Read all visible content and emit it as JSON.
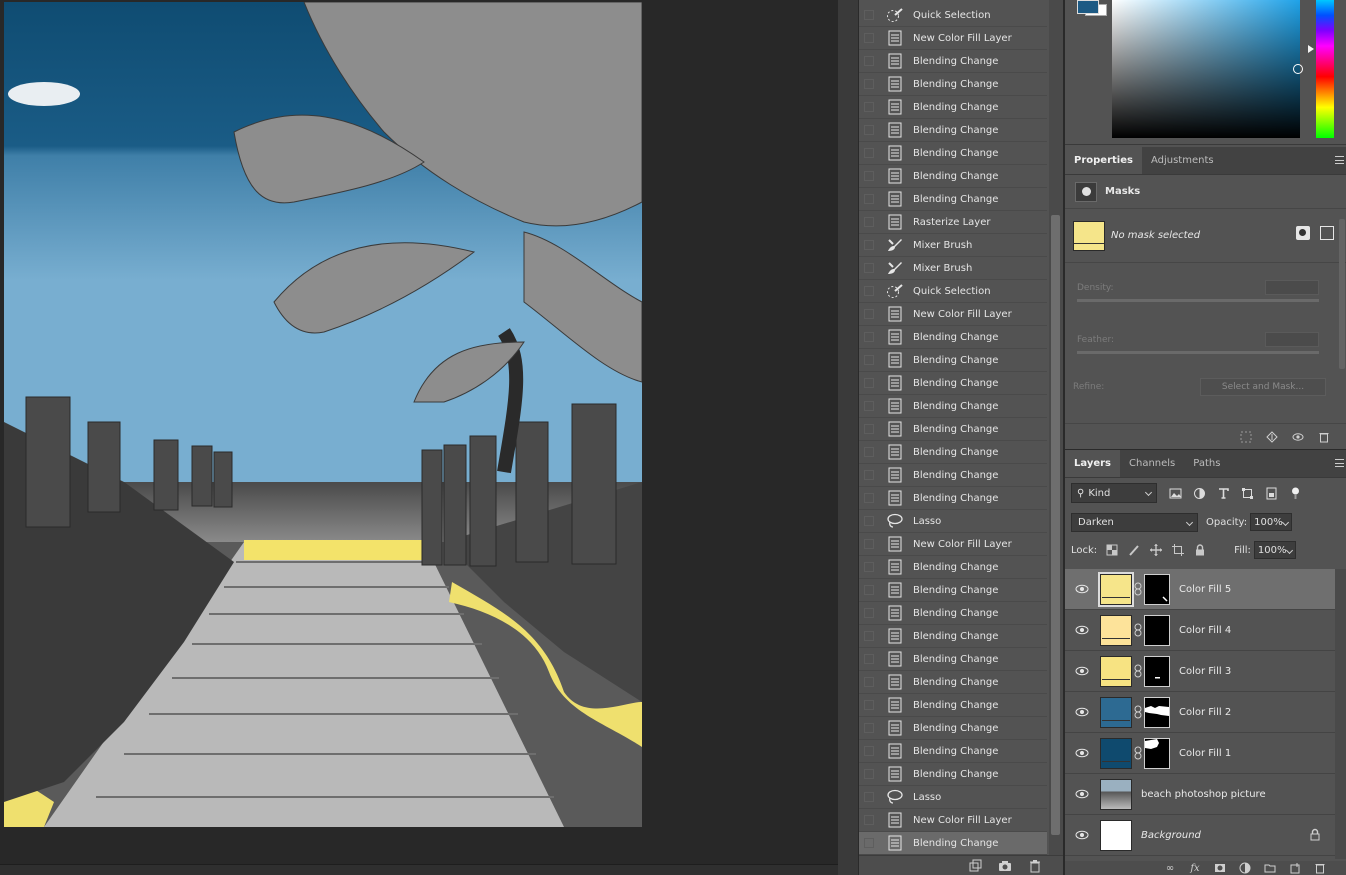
{
  "history": {
    "items": [
      {
        "label": "Quick Selection",
        "icon": "quick-selection-icon"
      },
      {
        "label": "New Color Fill Layer",
        "icon": "history-doc-icon"
      },
      {
        "label": "Blending Change",
        "icon": "history-doc-icon"
      },
      {
        "label": "Blending Change",
        "icon": "history-doc-icon"
      },
      {
        "label": "Blending Change",
        "icon": "history-doc-icon"
      },
      {
        "label": "Blending Change",
        "icon": "history-doc-icon"
      },
      {
        "label": "Blending Change",
        "icon": "history-doc-icon"
      },
      {
        "label": "Blending Change",
        "icon": "history-doc-icon"
      },
      {
        "label": "Blending Change",
        "icon": "history-doc-icon"
      },
      {
        "label": "Rasterize Layer",
        "icon": "history-doc-icon"
      },
      {
        "label": "Mixer Brush",
        "icon": "mixer-brush-icon"
      },
      {
        "label": "Mixer Brush",
        "icon": "mixer-brush-icon"
      },
      {
        "label": "Quick Selection",
        "icon": "quick-selection-icon"
      },
      {
        "label": "New Color Fill Layer",
        "icon": "history-doc-icon"
      },
      {
        "label": "Blending Change",
        "icon": "history-doc-icon"
      },
      {
        "label": "Blending Change",
        "icon": "history-doc-icon"
      },
      {
        "label": "Blending Change",
        "icon": "history-doc-icon"
      },
      {
        "label": "Blending Change",
        "icon": "history-doc-icon"
      },
      {
        "label": "Blending Change",
        "icon": "history-doc-icon"
      },
      {
        "label": "Blending Change",
        "icon": "history-doc-icon"
      },
      {
        "label": "Blending Change",
        "icon": "history-doc-icon"
      },
      {
        "label": "Blending Change",
        "icon": "history-doc-icon"
      },
      {
        "label": "Lasso",
        "icon": "lasso-icon"
      },
      {
        "label": "New Color Fill Layer",
        "icon": "history-doc-icon"
      },
      {
        "label": "Blending Change",
        "icon": "history-doc-icon"
      },
      {
        "label": "Blending Change",
        "icon": "history-doc-icon"
      },
      {
        "label": "Blending Change",
        "icon": "history-doc-icon"
      },
      {
        "label": "Blending Change",
        "icon": "history-doc-icon"
      },
      {
        "label": "Blending Change",
        "icon": "history-doc-icon"
      },
      {
        "label": "Blending Change",
        "icon": "history-doc-icon"
      },
      {
        "label": "Blending Change",
        "icon": "history-doc-icon"
      },
      {
        "label": "Blending Change",
        "icon": "history-doc-icon"
      },
      {
        "label": "Blending Change",
        "icon": "history-doc-icon"
      },
      {
        "label": "Blending Change",
        "icon": "history-doc-icon"
      },
      {
        "label": "Lasso",
        "icon": "lasso-icon"
      },
      {
        "label": "New Color Fill Layer",
        "icon": "history-doc-icon"
      },
      {
        "label": "Blending Change",
        "icon": "history-doc-icon",
        "active": true
      }
    ]
  },
  "color_picker": {
    "foreground": "#1d5a84",
    "background": "#ffffff"
  },
  "properties": {
    "tabs": [
      "Properties",
      "Adjustments"
    ],
    "section": "Masks",
    "status": "No mask selected",
    "density_label": "Density:",
    "feather_label": "Feather:",
    "refine_label": "Refine:",
    "select_mask_button": "Select and Mask..."
  },
  "layers": {
    "tabs": [
      "Layers",
      "Channels",
      "Paths"
    ],
    "filter": "Kind",
    "blend_mode": "Darken",
    "opacity_label": "Opacity:",
    "opacity": "100%",
    "lock_label": "Lock:",
    "fill_label": "Fill:",
    "fill": "100%",
    "items": [
      {
        "name": "Color Fill 5",
        "color": "#f6e58a",
        "active": true
      },
      {
        "name": "Color Fill 4",
        "color": "#fde39a"
      },
      {
        "name": "Color Fill 3",
        "color": "#f7e382"
      },
      {
        "name": "Color Fill 2",
        "color": "#2d6a92"
      },
      {
        "name": "Color Fill 1",
        "color": "#0f4a6e"
      },
      {
        "name": "beach photoshop picture",
        "color": "#888888"
      },
      {
        "name": "Background",
        "color": "#ffffff"
      }
    ]
  }
}
